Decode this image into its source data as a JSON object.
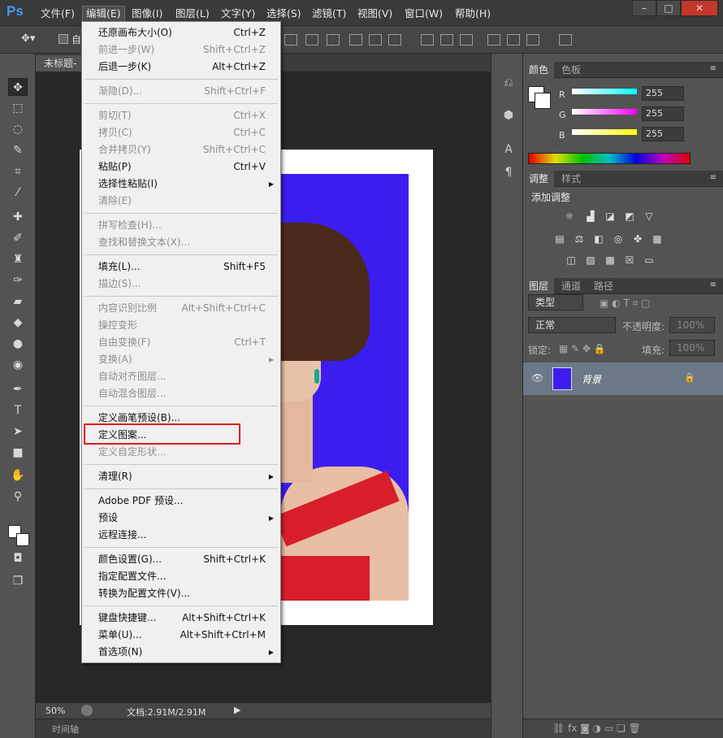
{
  "app": {
    "logo": "Ps"
  },
  "menubar": {
    "items": [
      "文件(F)",
      "编辑(E)",
      "图像(I)",
      "图层(L)",
      "文字(Y)",
      "选择(S)",
      "滤镜(T)",
      "视图(V)",
      "窗口(W)",
      "帮助(H)"
    ],
    "window_buttons": [
      "–",
      "□",
      "✕"
    ]
  },
  "optbar": {
    "checkbox_label": "自"
  },
  "document": {
    "tab_title": "未标题-",
    "zoom": "50%",
    "doc_info": "文档:2.91M/2.91M",
    "timeline_label": "时间轴"
  },
  "edit_menu": {
    "items": [
      {
        "label": "还原画布大小(O)",
        "shortcut": "Ctrl+Z",
        "enabled": true
      },
      {
        "label": "前进一步(W)",
        "shortcut": "Shift+Ctrl+Z",
        "enabled": false
      },
      {
        "label": "后退一步(K)",
        "shortcut": "Alt+Ctrl+Z",
        "enabled": true
      },
      {
        "label": "渐隐(D)...",
        "shortcut": "Shift+Ctrl+F",
        "enabled": false
      },
      {
        "label": "剪切(T)",
        "shortcut": "Ctrl+X",
        "enabled": false
      },
      {
        "label": "拷贝(C)",
        "shortcut": "Ctrl+C",
        "enabled": false
      },
      {
        "label": "合并拷贝(Y)",
        "shortcut": "Shift+Ctrl+C",
        "enabled": false
      },
      {
        "label": "粘贴(P)",
        "shortcut": "Ctrl+V",
        "enabled": true
      },
      {
        "label": "选择性粘贴(I)",
        "shortcut": "",
        "enabled": true,
        "submenu": true
      },
      {
        "label": "清除(E)",
        "shortcut": "",
        "enabled": false
      },
      {
        "label": "拼写检查(H)...",
        "shortcut": "",
        "enabled": false
      },
      {
        "label": "查找和替换文本(X)...",
        "shortcut": "",
        "enabled": false
      },
      {
        "label": "填充(L)...",
        "shortcut": "Shift+F5",
        "enabled": true
      },
      {
        "label": "描边(S)...",
        "shortcut": "",
        "enabled": false
      },
      {
        "label": "内容识别比例",
        "shortcut": "Alt+Shift+Ctrl+C",
        "enabled": false
      },
      {
        "label": "操控变形",
        "shortcut": "",
        "enabled": false
      },
      {
        "label": "自由变换(F)",
        "shortcut": "Ctrl+T",
        "enabled": false
      },
      {
        "label": "变换(A)",
        "shortcut": "",
        "enabled": false,
        "submenu": true
      },
      {
        "label": "自动对齐图层...",
        "shortcut": "",
        "enabled": false
      },
      {
        "label": "自动混合图层...",
        "shortcut": "",
        "enabled": false
      },
      {
        "label": "定义画笔预设(B)...",
        "shortcut": "",
        "enabled": true
      },
      {
        "label": "定义图案...",
        "shortcut": "",
        "enabled": true
      },
      {
        "label": "定义自定形状...",
        "shortcut": "",
        "enabled": false
      },
      {
        "label": "清理(R)",
        "shortcut": "",
        "enabled": true,
        "submenu": true
      },
      {
        "label": "Adobe PDF 预设...",
        "shortcut": "",
        "enabled": true
      },
      {
        "label": "预设",
        "shortcut": "",
        "enabled": true,
        "submenu": true
      },
      {
        "label": "远程连接...",
        "shortcut": "",
        "enabled": true
      },
      {
        "label": "颜色设置(G)...",
        "shortcut": "Shift+Ctrl+K",
        "enabled": true
      },
      {
        "label": "指定配置文件...",
        "shortcut": "",
        "enabled": true
      },
      {
        "label": "转换为配置文件(V)...",
        "shortcut": "",
        "enabled": true
      },
      {
        "label": "键盘快捷键...",
        "shortcut": "Alt+Shift+Ctrl+K",
        "enabled": true
      },
      {
        "label": "菜单(U)...",
        "shortcut": "Alt+Shift+Ctrl+M",
        "enabled": true
      },
      {
        "label": "首选项(N)",
        "shortcut": "",
        "enabled": true,
        "submenu": true
      }
    ]
  },
  "color_panel": {
    "tabs": [
      "颜色",
      "色板"
    ],
    "channels": [
      {
        "name": "R",
        "value": "255",
        "gradient": "#00ffff"
      },
      {
        "name": "G",
        "value": "255",
        "gradient": "#ff00ff"
      },
      {
        "name": "B",
        "value": "255",
        "gradient": "#ffff00"
      }
    ]
  },
  "adjust_panel": {
    "tabs": [
      "调整",
      "样式"
    ],
    "title": "添加调整"
  },
  "layers_panel": {
    "tabs": [
      "图层",
      "通道",
      "路径"
    ],
    "filter_label": "类型",
    "blend_mode": "正常",
    "opacity_label": "不透明度:",
    "opacity_value": "100%",
    "lock_label": "锁定:",
    "fill_label": "填充:",
    "fill_value": "100%",
    "layer_name": "背景"
  },
  "colors": {
    "accent_red": "#e0191e",
    "canvas_blue": "#3b1eef"
  }
}
